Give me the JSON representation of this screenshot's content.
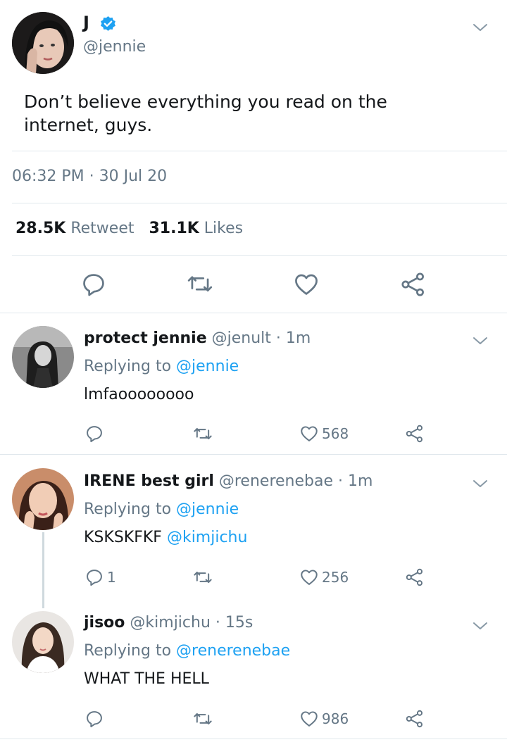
{
  "main_tweet": {
    "name": "J",
    "handle": "@jennie",
    "text": "Don’t believe everything you read on the internet, guys.",
    "timestamp": "06:32 PM · 30 Jul 20",
    "retweets_count": "28.5K",
    "retweets_label": "Retweet",
    "likes_count": "31.1K",
    "likes_label": "Likes",
    "verified": true
  },
  "replies": [
    {
      "name": "protect jennie",
      "handle": "@jenult",
      "time": "· 1m",
      "replying_label": "Replying to",
      "replying_to": "@jennie",
      "text": "lmfaoooooooo",
      "text_mention": "",
      "reply_count": "",
      "like_count": "568"
    },
    {
      "name": "IRENE best girl",
      "handle": "@renerenebae",
      "time": "· 1m",
      "replying_label": "Replying to",
      "replying_to": "@jennie",
      "text": "KSKSKFKF",
      "text_mention": "@kimjichu",
      "reply_count": "1",
      "like_count": "256"
    },
    {
      "name": "jisoo",
      "handle": "@kimjichu",
      "time": "· 15s",
      "replying_label": "Replying to",
      "replying_to": "@renerenebae",
      "text": "WHAT THE HELL",
      "text_mention": "",
      "reply_count": "",
      "like_count": "986"
    }
  ],
  "icons": [
    "chevron-down-icon",
    "verified-icon",
    "reply-icon",
    "retweet-icon",
    "like-icon",
    "share-icon"
  ],
  "colors": {
    "link": "#1da1f2",
    "secondary_text": "#657786",
    "primary_text": "#14171a",
    "divider": "#e1e8ed"
  }
}
